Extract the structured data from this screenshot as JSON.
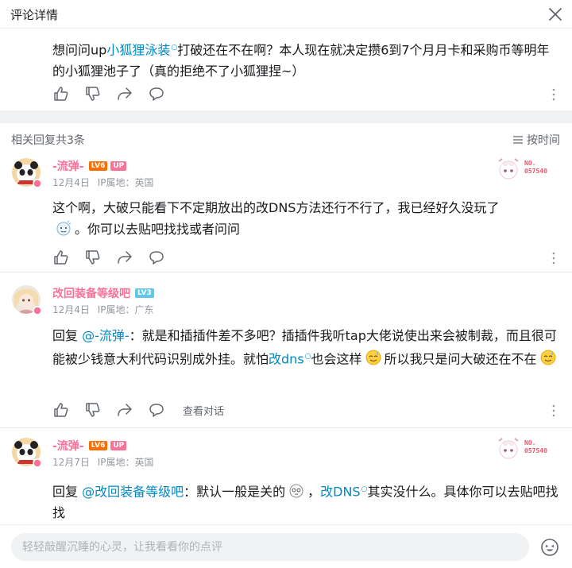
{
  "header": {
    "title": "评论详情"
  },
  "main_comment": {
    "text_part1": "想问问up",
    "link_text": "小狐狸泳装",
    "text_part2": "打破还在不在啊？本人现在就决定攒6到7个月月卡和采购币等明年的小狐狸池子了（真的拒绝不了小狐狸捏~）"
  },
  "reply_section": {
    "count_label": "相关回复共3条",
    "sort_label": "按时间"
  },
  "replies": [
    {
      "username": "-流弹-",
      "level": "LV6",
      "up_tag": "UP",
      "date": "12月4日",
      "ip": "IP属地：英国",
      "badge_no": "NO.",
      "badge_num": "057540",
      "text_part1": "这个啊，大破只能看下不定期放出的改DNS方法还行不行了，我已经好久没玩了",
      "text_part2": "。你可以去贴吧找找或者问问"
    },
    {
      "username": "改回装备等级吧",
      "level": "LV3",
      "date": "12月4日",
      "ip": "IP属地：广东",
      "reply_prefix": "回复 ",
      "reply_to": "@-流弹-",
      "text_part1": "：就是和插插件差不多吧？插插件我听tap大佬说使出来会被制裁，而且很可能被少钱意大利代码识别成外挂。就怕",
      "link_text": "改dns",
      "text_part2": "也会这样",
      "text_part3": "所以我只是问大破还在不在",
      "view_conversation": "查看对话"
    },
    {
      "username": "-流弹-",
      "level": "LV6",
      "up_tag": "UP",
      "date": "12月7日",
      "ip": "IP属地：英国",
      "badge_no": "NO.",
      "badge_num": "057540",
      "reply_prefix": "回复 ",
      "reply_to": "@改回装备等级吧",
      "text_part1": "：默认一般是关的",
      "text_part2": "，",
      "link_text": "改DNS",
      "text_part3": "其实没什么。具体你可以去贴吧找找"
    }
  ],
  "input": {
    "placeholder": "轻轻敲醒沉睡的心灵，让我看看你的点评"
  },
  "icons": {
    "like": "thumb-up-icon",
    "dislike": "thumb-down-icon",
    "share": "share-icon",
    "comment": "comment-bubble-icon",
    "more": "more-vertical-icon",
    "close": "close-icon",
    "sort": "sort-lines-icon",
    "emoji": "emoji-face-icon"
  },
  "colors": {
    "accent_pink": "#fb7299",
    "link_blue": "#008ac5",
    "lv6": "#ff6c00",
    "lv3": "#61c7e6"
  }
}
